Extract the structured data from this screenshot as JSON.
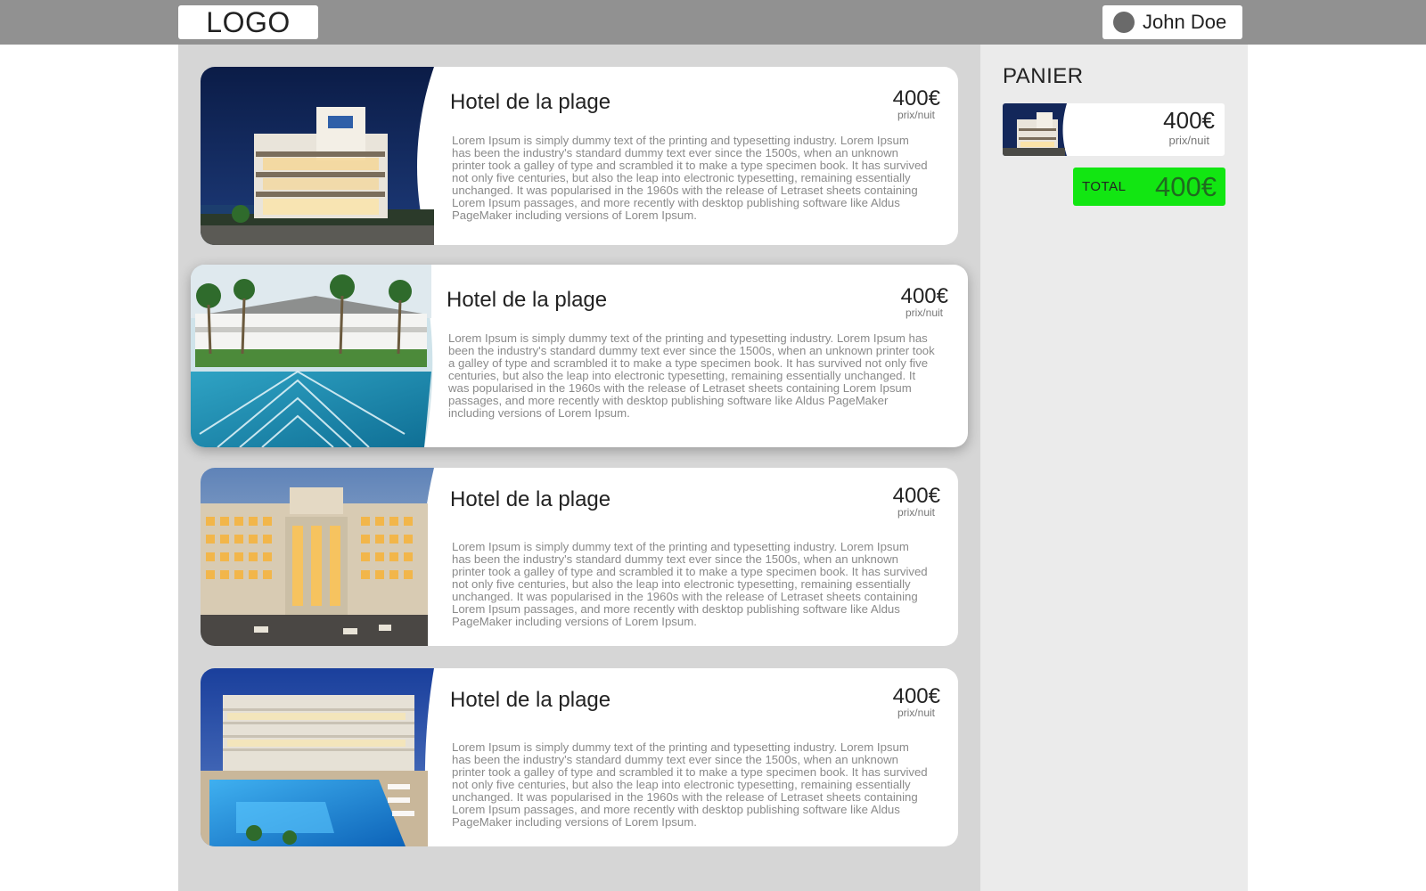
{
  "header": {
    "logo_text": "LOGO",
    "user_name": "John Doe"
  },
  "hotels": [
    {
      "title": "Hotel de la plage",
      "price": "400€",
      "unit": "prix/nuit",
      "description": "Lorem Ipsum is simply dummy text of the printing and typesetting industry. Lorem Ipsum has been the industry's standard dummy text ever since the 1500s, when an unknown printer took a galley of type and scrambled it to make a type specimen book. It has survived not only five centuries, but also the leap into electronic typesetting, remaining essentially unchanged. It was popularised in the 1960s with the release of Letraset sheets containing Lorem Ipsum passages, and more recently with desktop publishing software like Aldus PageMaker including versions of Lorem Ipsum.",
      "photo": "hotel-night-facade-photo"
    },
    {
      "title": "Hotel de la plage",
      "price": "400€",
      "unit": "prix/nuit",
      "description": "Lorem Ipsum is simply dummy text of the printing and typesetting industry. Lorem Ipsum has been the industry's standard dummy text ever since the 1500s, when an unknown printer took a galley of type and scrambled it to make a type specimen book. It has survived not only five centuries, but also the leap into electronic typesetting, remaining essentially unchanged. It was popularised in the 1960s with the release of Letraset sheets containing Lorem Ipsum passages, and more recently with desktop publishing software like Aldus PageMaker including versions of Lorem Ipsum.",
      "photo": "hotel-pool-palms-photo"
    },
    {
      "title": "Hotel de la plage",
      "price": "400€",
      "unit": "prix/nuit",
      "description": "Lorem Ipsum is simply dummy text of the printing and typesetting industry. Lorem Ipsum has been the industry's standard dummy text ever since the 1500s, when an unknown printer took a galley of type and scrambled it to make a type specimen book. It has survived not only five centuries, but also the leap into electronic typesetting, remaining essentially unchanged. It was popularised in the 1960s with the release of Letraset sheets containing Lorem Ipsum passages, and more recently with desktop publishing software like Aldus PageMaker including versions of Lorem Ipsum.",
      "photo": "hotel-tower-evening-photo"
    },
    {
      "title": "Hotel de la plage",
      "price": "400€",
      "unit": "prix/nuit",
      "description": "Lorem Ipsum is simply dummy text of the printing and typesetting industry. Lorem Ipsum has been the industry's standard dummy text ever since the 1500s, when an unknown printer took a galley of type and scrambled it to make a type specimen book. It has survived not only five centuries, but also the leap into electronic typesetting, remaining essentially unchanged. It was popularised in the 1960s with the release of Letraset sheets containing Lorem Ipsum passages, and more recently with desktop publishing software like Aldus PageMaker including versions of Lorem Ipsum.",
      "photo": "hotel-resort-pool-dusk-photo"
    }
  ],
  "cart": {
    "title": "PANIER",
    "item": {
      "price": "400€",
      "unit": "prix/nuit"
    },
    "total_label": "TOTAL",
    "total_value": "400€"
  },
  "colors": {
    "topbar": "#919191",
    "list_background": "#d6d6d6",
    "cart_background": "#ebebeb",
    "total_accent": "#12e612"
  }
}
